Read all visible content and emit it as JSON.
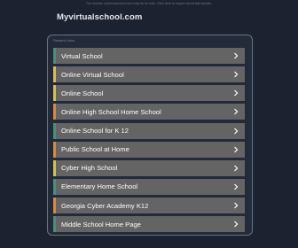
{
  "top_note": "The domain myvirtualschool.com may be for sale. Click here to inquire about this domain.",
  "site_title": "Myvirtualschool.com",
  "panel_label": "Related Links",
  "links": [
    {
      "label": "Virtual School",
      "accent": "#4a8f7a"
    },
    {
      "label": "Online Virtual School",
      "accent": "#d4c24a"
    },
    {
      "label": "Online School",
      "accent": "#d4c24a"
    },
    {
      "label": "Online High School Home School",
      "accent": "#d98a3a"
    },
    {
      "label": "Online School for K 12",
      "accent": "#4a8f7a"
    },
    {
      "label": "Public School at Home",
      "accent": "#d98a3a"
    },
    {
      "label": "Cyber High School",
      "accent": "#d4c24a"
    },
    {
      "label": "Elementary Home School",
      "accent": "#4a8f7a"
    },
    {
      "label": "Georgia Cyber Academy K12",
      "accent": "#d98a3a"
    },
    {
      "label": "Middle School Home Page",
      "accent": "#4a8f7a"
    }
  ],
  "chevron_icon": "chevron-right-icon",
  "colors": {
    "background": "#1d2230",
    "row": "#646464",
    "panel_border": "#6a7488"
  }
}
